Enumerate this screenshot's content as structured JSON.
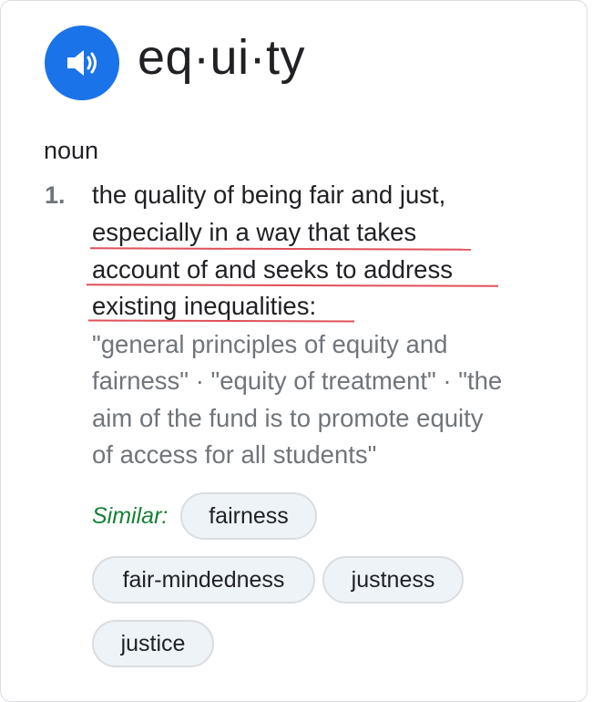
{
  "entry": {
    "headword": "eq·ui·ty",
    "part_of_speech": "noun",
    "speaker_icon": "speaker-icon",
    "accent_color": "#1a73e8",
    "annotation_color": "#e0505a"
  },
  "definition": {
    "number": "1.",
    "lines": [
      "the quality of being fair and just,",
      "especially in a way that takes",
      "account of and seeks to address",
      "existing inequalities:"
    ],
    "examples": [
      "\"general principles of equity and",
      "fairness\" · \"equity of treatment\" · \"the",
      "aim of the fund is to promote equity",
      "of access for all students\""
    ]
  },
  "similar": {
    "label": "Similar:",
    "label_color": "#188038",
    "chips": [
      "fairness",
      "fair-mindedness",
      "justness",
      "justice"
    ]
  }
}
